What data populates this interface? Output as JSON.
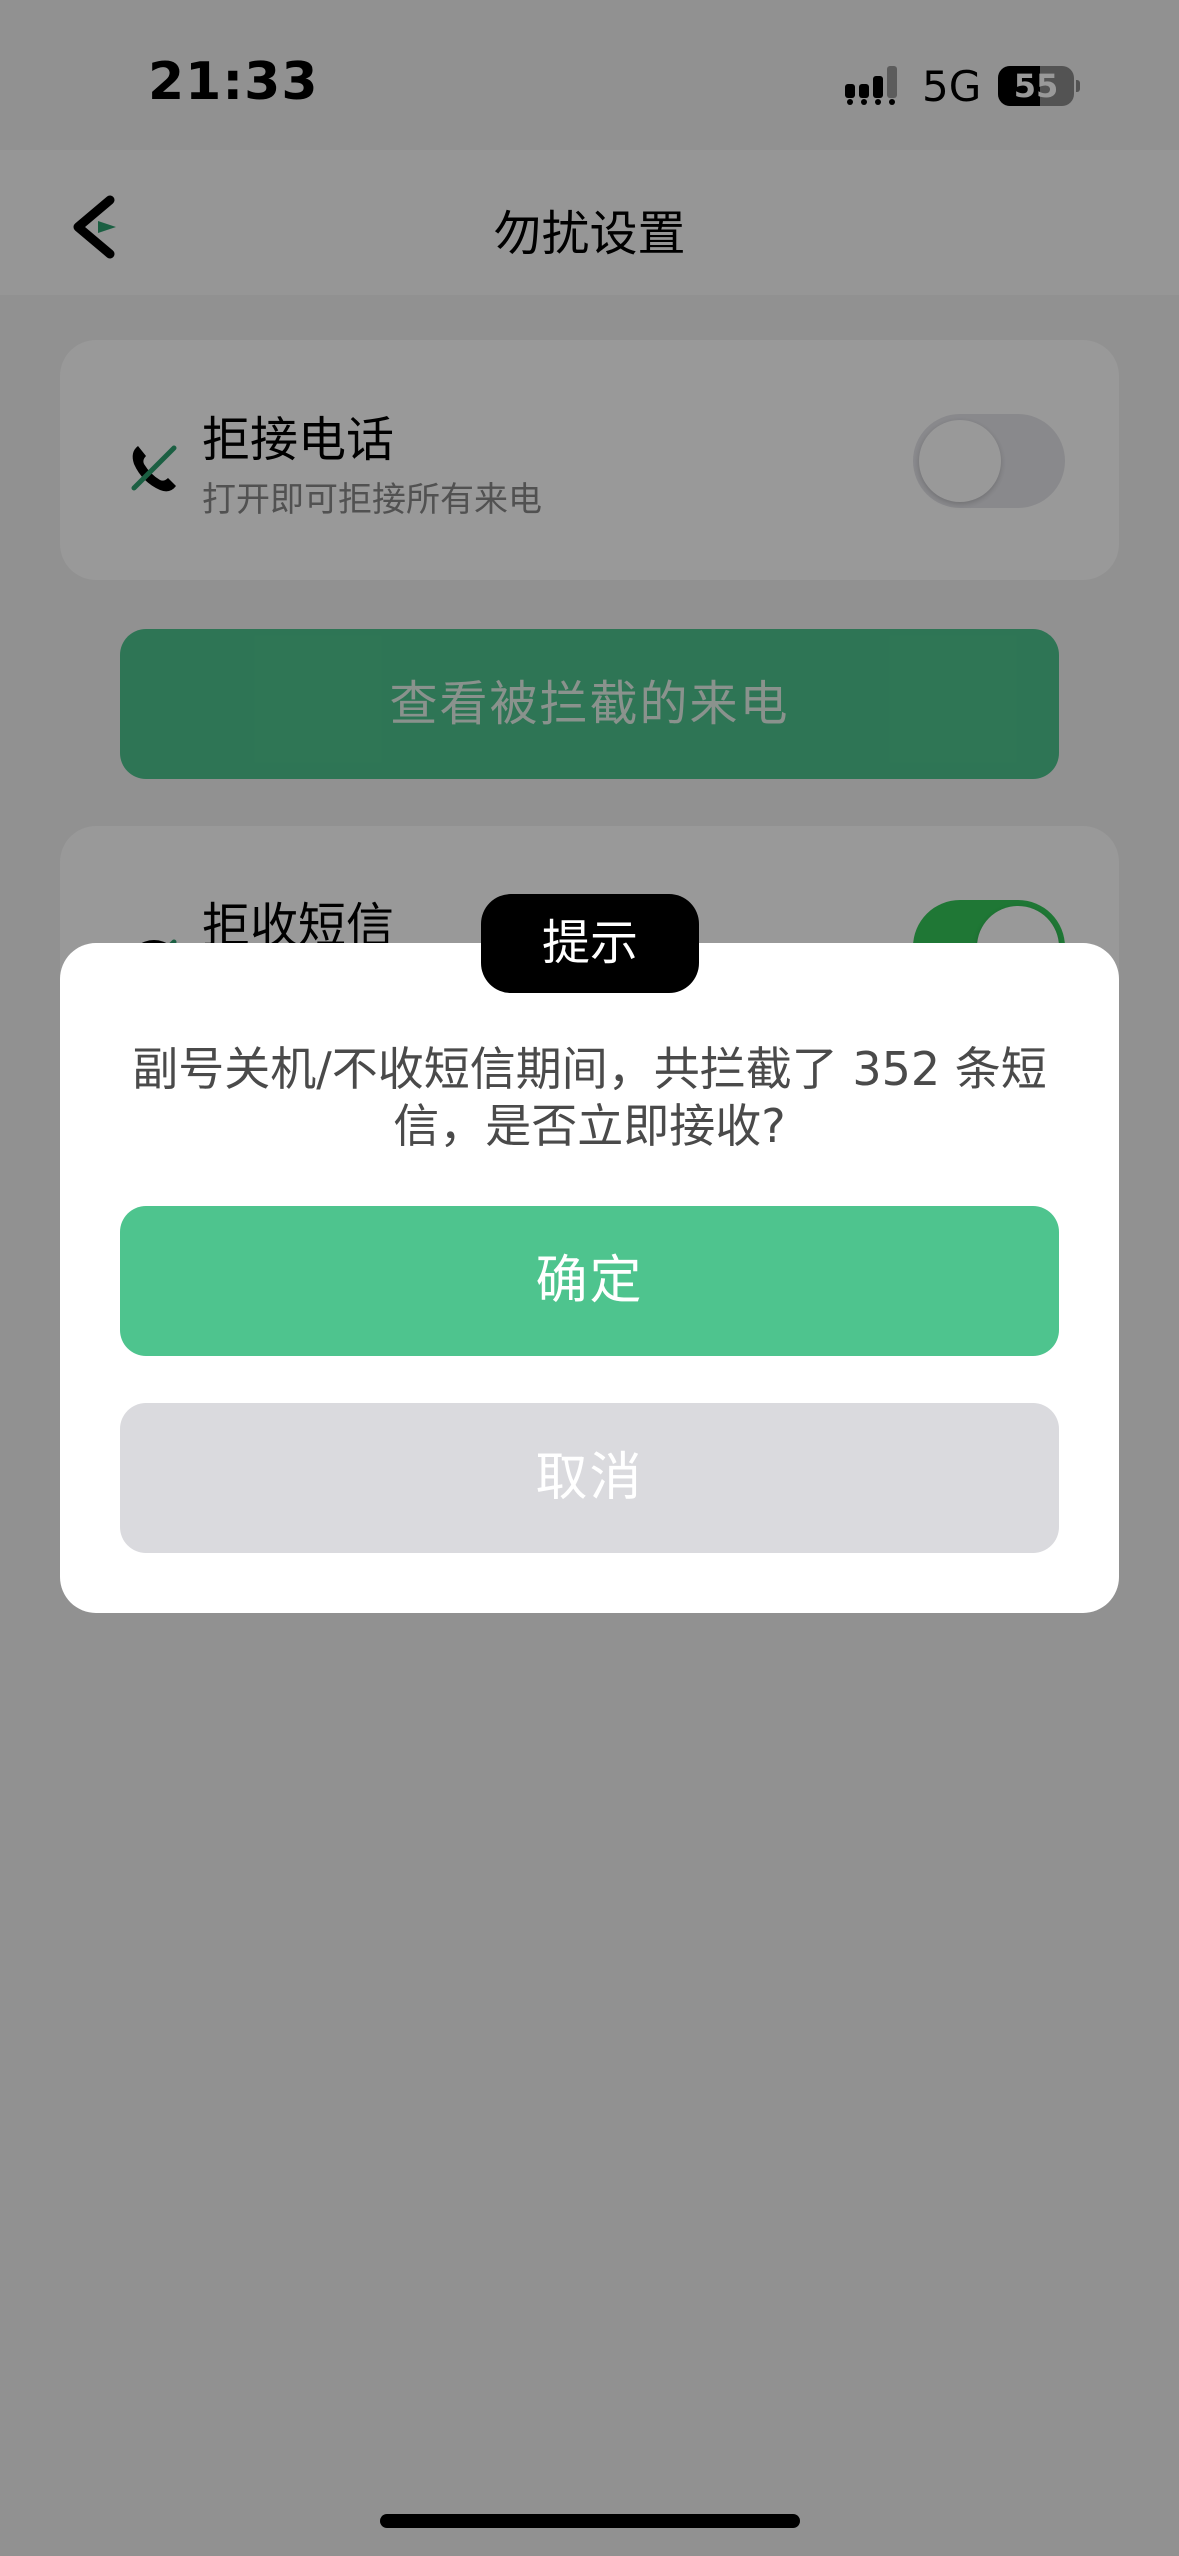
{
  "status_bar": {
    "time": "21:33",
    "network": "5G",
    "battery_level": "55",
    "battery_percent": 55,
    "signal_icon": "signal-bars-icon",
    "battery_icon": "battery-icon"
  },
  "nav": {
    "title": "勿扰设置",
    "back_icon": "back-arrow-icon"
  },
  "reject_calls": {
    "title": "拒接电话",
    "subtitle": "打开即可拒接所有来电",
    "enabled": false,
    "icon": "phone-blocked-icon"
  },
  "view_blocked_calls": {
    "label": "查看被拦截的来电"
  },
  "reject_sms": {
    "title": "拒收短信",
    "enabled": true,
    "icon": "sms-blocked-icon"
  },
  "dialog": {
    "tag": "提示",
    "message": "副号关机/不收短信期间，共拦截了 352 条短信，是否立即接收?",
    "confirm_label": "确定",
    "cancel_label": "取消"
  },
  "colors": {
    "accent": "#4ec48e",
    "toggle_on": "#34c759",
    "toggle_off": "#e5e5ea",
    "cancel_bg": "#dadade"
  }
}
